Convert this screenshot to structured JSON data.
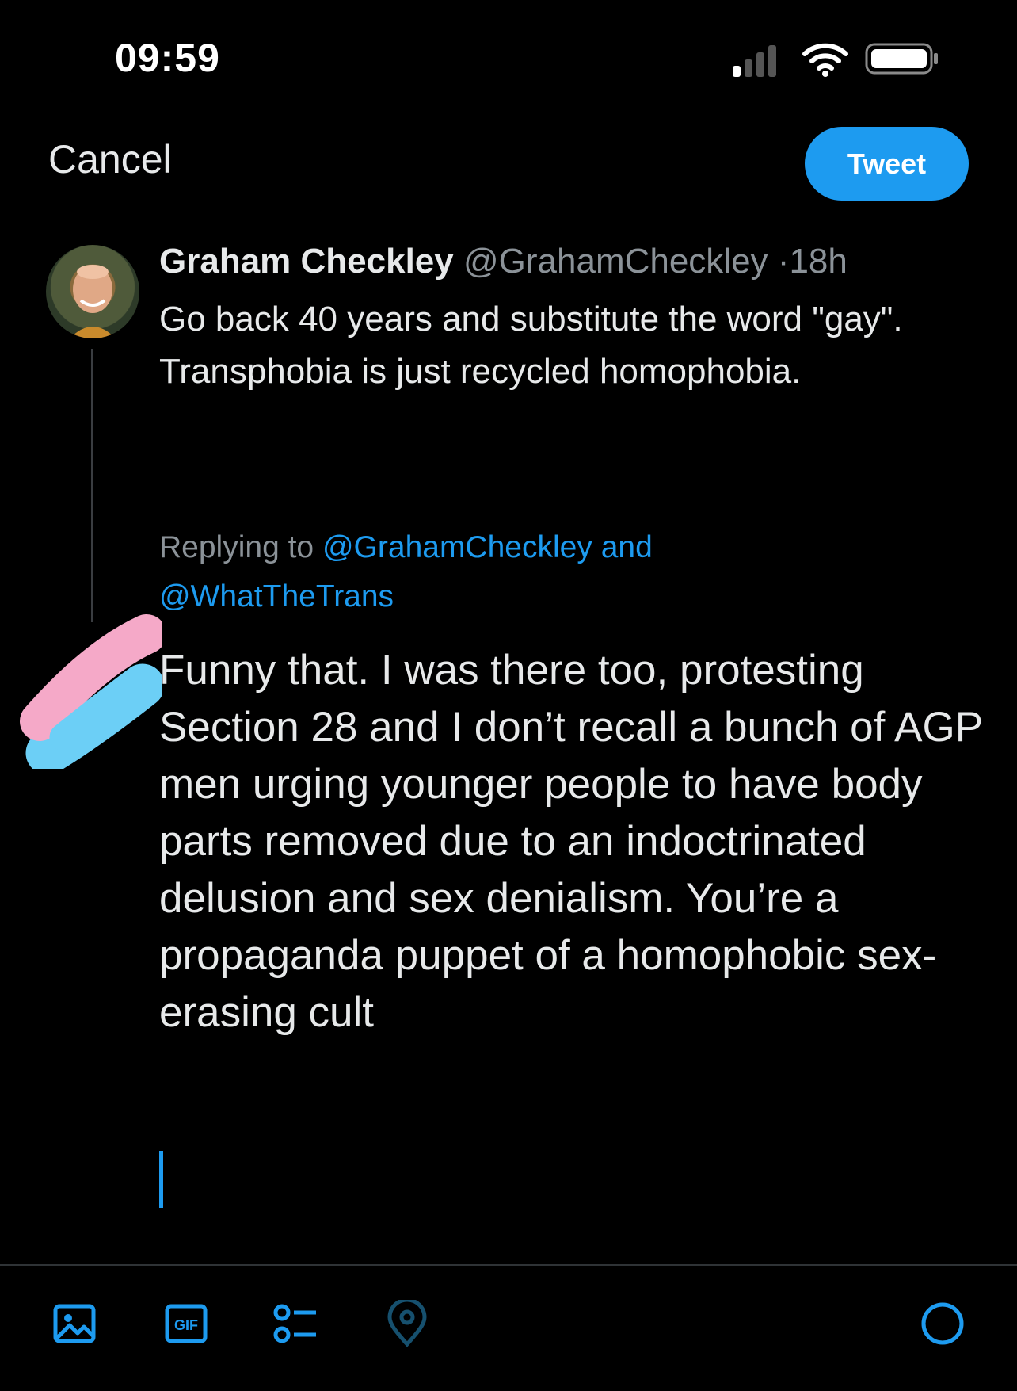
{
  "status_bar": {
    "time": "09:59",
    "icons": [
      "signal-icon",
      "wifi-icon",
      "battery-icon"
    ]
  },
  "top_bar": {
    "cancel_label": "Cancel",
    "tweet_label": "Tweet"
  },
  "original_tweet": {
    "author_name": "Graham Checkley",
    "author_handle": "@GrahamCheckley",
    "separator": "·",
    "time_ago": "18h",
    "text": "Go back 40 years and substitute the word \"gay\".  Transphobia is just recycled homophobia."
  },
  "reply": {
    "replying_prefix": "Replying to",
    "replying_to_1": "@GrahamCheckley",
    "replying_and": "and",
    "replying_to_2": "@WhatTheTrans",
    "text": "Funny that. I was there too, protesting Section 28 and I don’t recall a bunch of AGP men urging younger people to have body parts removed due to an indoctrinated delusion and sex denialism. You’re  a propaganda puppet of a homophobic sex-erasing cult"
  },
  "toolbar": {
    "icons": [
      "image-icon",
      "gif-icon",
      "poll-icon",
      "location-icon",
      "character-count-icon"
    ]
  },
  "colors": {
    "background": "#000000",
    "accent": "#1d9bf0",
    "text": "#e7e9ea",
    "muted": "#8b9298"
  }
}
